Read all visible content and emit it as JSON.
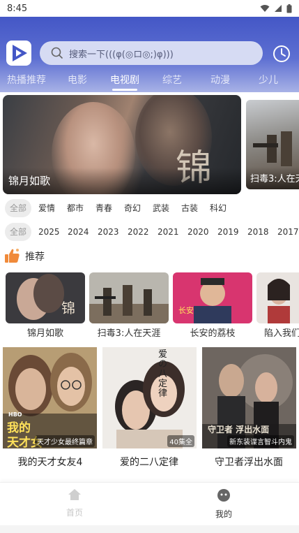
{
  "status_bar": {
    "time": "8:45",
    "icons": [
      "wifi-icon",
      "signal-icon",
      "battery-icon"
    ]
  },
  "header": {
    "search_placeholder": "搜索一下(((φ(◎ロ◎;)φ)))",
    "tabs": [
      {
        "label": "热播推荐",
        "active": false
      },
      {
        "label": "电影",
        "active": false
      },
      {
        "label": "电视剧",
        "active": true
      },
      {
        "label": "综艺",
        "active": false
      },
      {
        "label": "动漫",
        "active": false
      },
      {
        "label": "少儿",
        "active": false
      }
    ]
  },
  "banner": {
    "main_title": "锦月如歌",
    "main_calligraphy": "锦月",
    "side_title": "扫毒3:人在天"
  },
  "filters": {
    "genres": [
      "全部",
      "爱情",
      "都市",
      "青春",
      "奇幻",
      "武装",
      "古装",
      "科幻"
    ],
    "years": [
      "全部",
      "2025",
      "2024",
      "2023",
      "2022",
      "2021",
      "2020",
      "2019",
      "2018",
      "2017"
    ]
  },
  "recommend": {
    "title": "推荐",
    "small_cards": [
      "锦月如歌",
      "扫毒3:人在天涯",
      "长安的荔枝",
      "陷入我们"
    ],
    "large_cards": [
      {
        "title": "我的天才女友4",
        "badge": "天才少女最终篇章",
        "poster_text_1": "我的",
        "poster_text_2": "天才女",
        "poster_logo": "HBO"
      },
      {
        "title": "爱的二八定律",
        "badge": "40集全",
        "poster_text_1": "爱の八定律"
      },
      {
        "title": "守卫者浮出水面",
        "badge": "新东装谍言智斗内鬼",
        "poster_text_1": "守卫者 浮出水面"
      }
    ]
  },
  "bottom_nav": {
    "home": "首页",
    "mine": "我的"
  },
  "colors": {
    "header_start": "#4457c6",
    "header_end": "#a8b2e6",
    "accent_orange": "#f08a3a"
  }
}
